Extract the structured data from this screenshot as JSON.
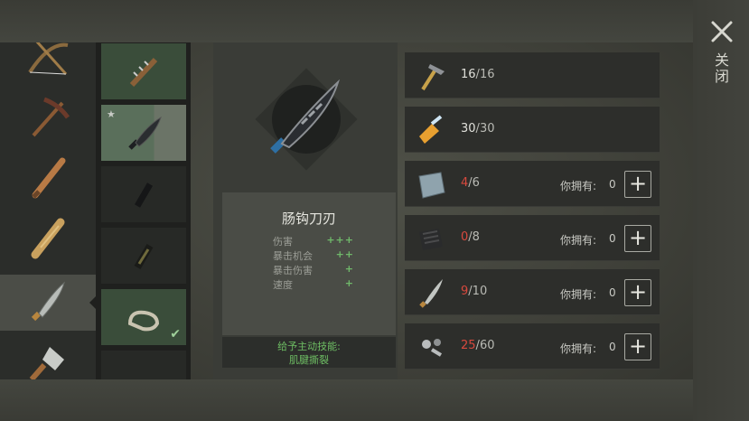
{
  "item": {
    "name": "肠钩刀刃",
    "stats": [
      {
        "label": "伤害",
        "value": "+++"
      },
      {
        "label": "暴击机会",
        "value": "++"
      },
      {
        "label": "暴击伤害",
        "value": "+"
      },
      {
        "label": "速度",
        "value": "+"
      }
    ],
    "skill_line1": "给予主动技能:",
    "skill_line2": "肌腱撕裂"
  },
  "requirements": [
    {
      "icon": "hammer-icon",
      "have": "16",
      "need": "16",
      "owned_label": "",
      "owned": "",
      "addable": false,
      "low": false
    },
    {
      "icon": "glue-bottle-icon",
      "have": "30",
      "need": "30",
      "owned_label": "",
      "owned": "",
      "addable": false,
      "low": false
    },
    {
      "icon": "metal-plate-icon",
      "have": "4",
      "need": "6",
      "owned_label": "你拥有:",
      "owned": "0",
      "addable": true,
      "low": true
    },
    {
      "icon": "rubber-sheet-icon",
      "have": "0",
      "need": "8",
      "owned_label": "你拥有:",
      "owned": "0",
      "addable": true,
      "low": true
    },
    {
      "icon": "machete-blade-icon",
      "have": "9",
      "need": "10",
      "owned_label": "你拥有:",
      "owned": "0",
      "addable": true,
      "low": true
    },
    {
      "icon": "bolts-icon",
      "have": "25",
      "need": "60",
      "owned_label": "你拥有:",
      "owned": "0",
      "addable": true,
      "low": true
    }
  ],
  "buttons": {
    "add": "+",
    "close": "关闭"
  },
  "weapons": [
    "crossbow-icon",
    "pickaxe-icon",
    "baseball-bat-icon",
    "wooden-club-icon",
    "machete-icon",
    "cleaver-icon"
  ],
  "variants": [
    "spiked-handle-icon",
    "hook-blade-icon",
    "grip-icon",
    "grip-wrapped-icon",
    "knuckle-guard-icon",
    "green-handle-icon"
  ],
  "colors": {
    "accent_green": "#6fb86a",
    "warning_red": "#d8493e"
  }
}
